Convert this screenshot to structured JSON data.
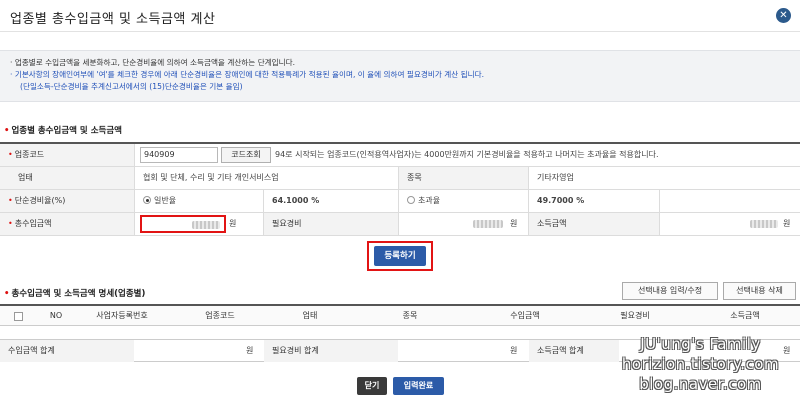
{
  "title": "업종별 총수입금액 및 소득금액 계산",
  "close_symbol": "✕",
  "notice": {
    "line1": "· 업종별로 수입금액을 세분화하고, 단순경비율에 의하여 소득금액을 계산하는 단계입니다.",
    "line2": "· 기본사항의 장애인여부에 '여'를 체크한 경우에 아래 단순경비율은 장애인에 대한 적용특례가 적용된 율이며, 이 율에 의하여 필요경비가 계산 됩니다.",
    "line3": "(단일소득-단순경비율 추계신고서에서의 (15)단순경비율은 기본 율임)"
  },
  "section1": {
    "title": "업종별 총수입금액 및 소득금액"
  },
  "form": {
    "code_label": "업종코드",
    "code_value": "940909",
    "code_button": "코드조회",
    "code_desc": "94로 시작되는 업종코드(인적용역사업자)는 4000만원까지 기본경비율을 적용하고 나머지는 초과율을 적용합니다.",
    "business_label": "업태",
    "business_value": "협회 및 단체, 수리 및 기타 개인서비스업",
    "item_label": "종목",
    "item_value": "기타자영업",
    "rate_label": "단순경비율(%)",
    "rate_general_label": "일반율",
    "rate_general_value": "64.1000 %",
    "rate_excess_label": "초과율",
    "rate_excess_value": "49.7000 %",
    "revenue_label": "총수입금액",
    "expense_label": "필요경비",
    "income_label": "소득금액",
    "won": "원"
  },
  "register_button": "등록하기",
  "section2": {
    "title": "총수입금액 및 소득금액 명세(업종별)",
    "edit_button": "선택내용 입력/수정",
    "delete_button": "선택내용 삭제"
  },
  "grid": {
    "columns": [
      "NO",
      "사업자등록번호",
      "업종코드",
      "업태",
      "종목",
      "수입금액",
      "필요경비",
      "소득금액"
    ]
  },
  "totals": {
    "revenue_label": "수입금액 합계",
    "expense_label": "필요경비 합계",
    "income_label": "소득금액 합계",
    "won": "원"
  },
  "buttons": {
    "close": "닫기",
    "complete": "입력완료"
  },
  "watermark": {
    "line1": "JU'ung's Family",
    "line2": "horizion.tistory.com",
    "line3": "blog.naver.com"
  },
  "colors": {
    "primary": "#2c5ba8",
    "highlight": "#e21414",
    "notice_text": "#1f4fb8",
    "dark_button": "#3a3a3a"
  }
}
